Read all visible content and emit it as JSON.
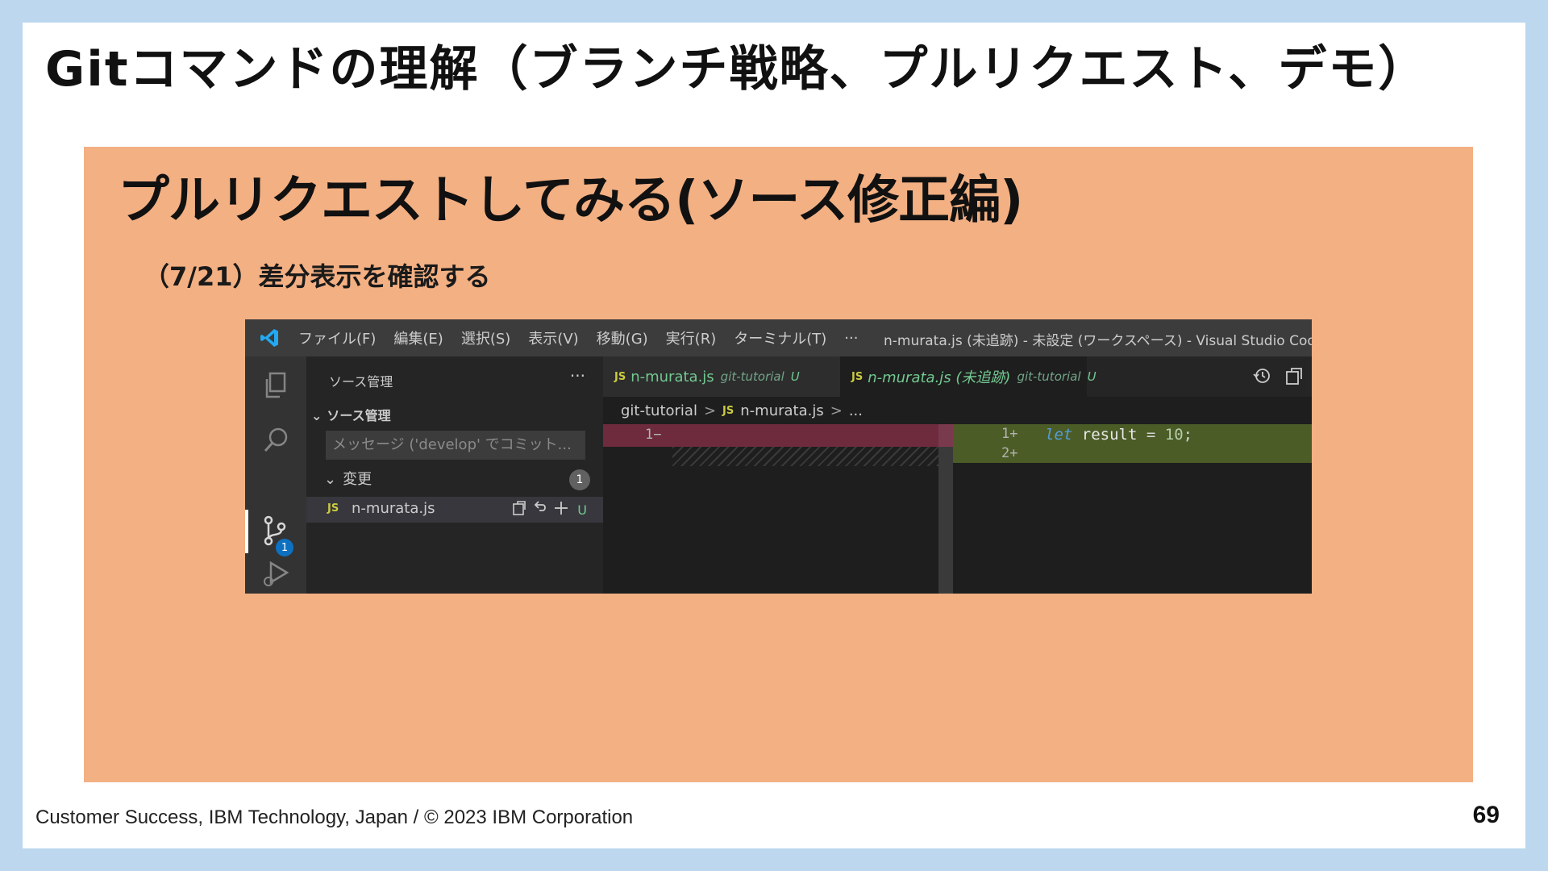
{
  "slide": {
    "title": "Gitコマンドの理解（ブランチ戦略、プルリクエスト、デモ）",
    "panel_title": "プルリクエストしてみる(ソース修正編)",
    "panel_subtitle": "（7/21）差分表示を確認する",
    "footer": "Customer Success, IBM Technology, Japan / © 2023 IBM Corporation",
    "page_number": "69"
  },
  "vscode": {
    "menu": [
      "ファイル(F)",
      "編集(E)",
      "選択(S)",
      "表示(V)",
      "移動(G)",
      "実行(R)",
      "ターミナル(T)",
      "···"
    ],
    "window_title": "n-murata.js (未追跡) - 未設定 (ワークスペース) - Visual Studio Code [...",
    "sidebar": {
      "header": "ソース管理",
      "more": "···",
      "section": "ソース管理",
      "commit_placeholder": "メッセージ ('develop' でコミット...",
      "changes_label": "変更",
      "changes_count": "1",
      "file": {
        "icon_label": "JS",
        "name": "n-murata.js",
        "status": "U"
      }
    },
    "activity_badge": "1",
    "tabs": [
      {
        "icon_label": "JS",
        "name": "n-murata.js",
        "folder": "git-tutorial",
        "status": "U"
      },
      {
        "icon_label": "JS",
        "name": "n-murata.js (未追跡)",
        "folder": "git-tutorial",
        "status": "U"
      }
    ],
    "breadcrumb": {
      "folder": "git-tutorial",
      "sep": ">",
      "icon_label": "JS",
      "file": "n-murata.js",
      "tail": "..."
    },
    "diff": {
      "left_line": "1−",
      "right_lines": [
        "1+",
        "2+"
      ],
      "code": {
        "keyword": "let",
        "variable": "result",
        "operator": "=",
        "number": "10",
        "terminator": ";"
      }
    },
    "colors": {
      "deleted": "#6e2b3d",
      "added": "#4b5c27",
      "untracked": "#73c991",
      "badge": "#0e70c0"
    }
  }
}
